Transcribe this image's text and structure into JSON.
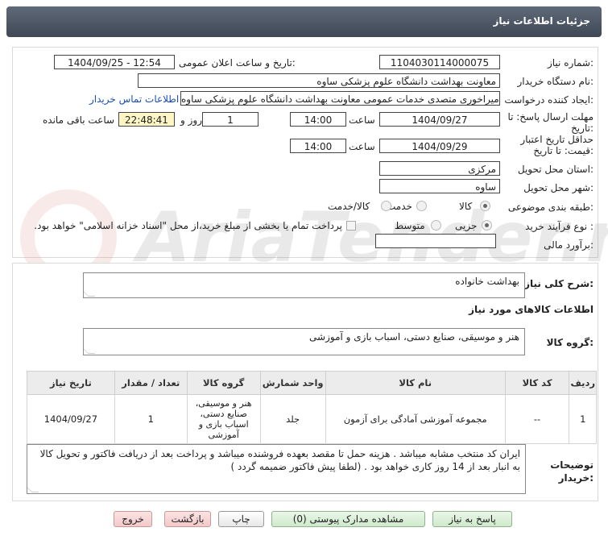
{
  "header": {
    "title": "جزئیات اطلاعات نیاز"
  },
  "form": {
    "need_number": {
      "label": "شماره نیاز:",
      "value": "1104030114000075"
    },
    "announce_datetime": {
      "label": "تاریخ و ساعت اعلان عمومی:",
      "value": "1404/09/25 - 12:54"
    },
    "buyer_org": {
      "label": "نام دستگاه خریدار:",
      "value": "معاونت بهداشت دانشگاه علوم پزشکی ساوه"
    },
    "requester": {
      "label": "ایجاد کننده درخواست:",
      "value": "جواد میراخوری متصدی خدمات عمومی معاونت بهداشت دانشگاه علوم پزشکی ساوه",
      "contact_link": "اطلاعات تماس خریدار"
    },
    "reply_deadline": {
      "label_line1": "مهلت ارسال پاسخ: تا",
      "label_line2": "تاریخ:",
      "date": "1404/09/27",
      "time_label": "ساعت",
      "time": "14:00",
      "days": "1",
      "days_label": "روز و",
      "remaining": "22:48:41",
      "remaining_label": "ساعت باقی مانده"
    },
    "validity_deadline": {
      "label_line1": "حداقل تاریخ اعتبار",
      "label_line2": "قیمت: تا تاریخ:",
      "date": "1404/09/29",
      "time_label": "ساعت",
      "time": "14:00"
    },
    "province": {
      "label": "استان محل تحویل:",
      "value": "مرکزی"
    },
    "city": {
      "label": "شهر محل تحویل:",
      "value": "ساوه"
    },
    "category": {
      "label": "طبقه بندی موضوعی:",
      "options": [
        "کالا",
        "خدمت",
        "کالا/خدمت"
      ],
      "selected": "کالا"
    },
    "purchase_type": {
      "label": "نوع فرآیند خرید :",
      "options": [
        "جزیی",
        "متوسط"
      ],
      "payment_note": "پرداخت تمام یا بخشی از مبلغ خرید،از محل \"اسناد خزانه اسلامی\" خواهد بود."
    },
    "estimate": {
      "label": "برآورد مالی:",
      "value": ""
    }
  },
  "description": {
    "label": "شرح کلی نیاز:",
    "value": "بهداشت خانواده"
  },
  "goods_info": {
    "title": "اطلاعات کالاهای مورد نیاز",
    "group_label": "گروه کالا:",
    "group_value": "هنر و موسیقی، صنایع دستی، اسباب بازی و آموزشی"
  },
  "table": {
    "headers": [
      "ردیف",
      "کد کالا",
      "نام کالا",
      "واحد شمارش",
      "گروه کالا",
      "تعداد / مقدار",
      "تاریخ نیاز"
    ],
    "rows": [
      [
        "1",
        "--",
        "مجموعه آموزشی آمادگی برای آزمون",
        "جلد",
        "هنر و موسیقی، صنایع دستی، اسباب بازی و آموزشی",
        "1",
        "1404/09/27"
      ]
    ]
  },
  "buyer_notes": {
    "label_line1": "توضیحات",
    "label_line2": "خریدار:",
    "value": "ایران کد منتخب مشابه میباشد . هزینه حمل تا مقصد بعهده فروشنده میباشد و پرداخت بعد از دریافت فاکتور و تحویل کالا به انبار بعد از 14 روز کاری خواهد بود . (لطفا پیش فاکتور ضمیمه گردد )"
  },
  "buttons": {
    "reply": "پاسخ به نیاز",
    "view_docs": "مشاهده مدارک پیوستی (0)",
    "print": "چاپ",
    "back": "بازگشت",
    "exit": "خروج"
  },
  "watermark": {
    "text": "AriaTender.neT"
  }
}
